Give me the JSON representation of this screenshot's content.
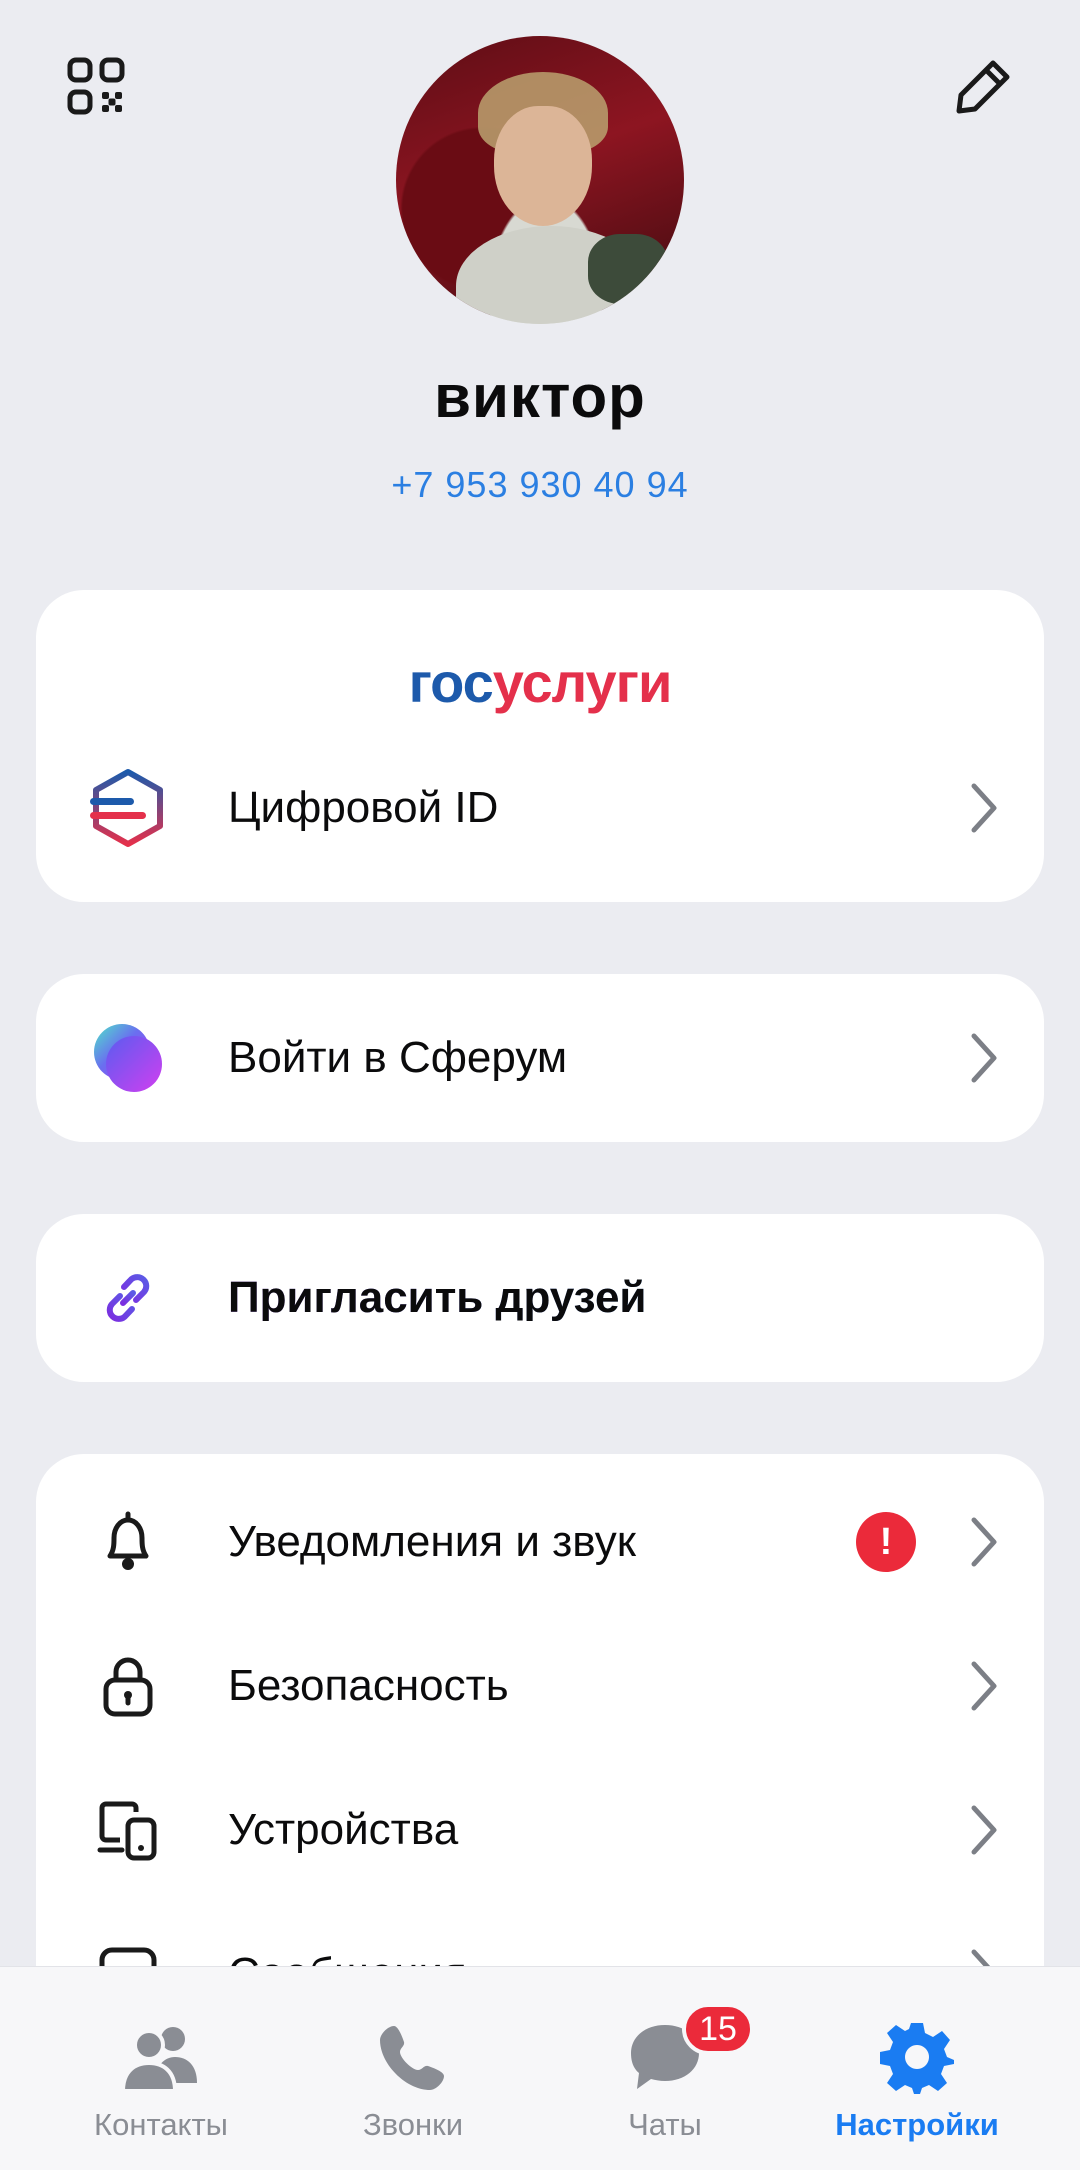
{
  "profile": {
    "name": "виктор",
    "phone": "+7 953 930 40 94"
  },
  "gosuslugi": {
    "logo_part1": "гос",
    "logo_part2": "услуги",
    "digital_id_label": "Цифровой ID"
  },
  "sferum": {
    "label": "Войти в Сферум"
  },
  "invite": {
    "label": "Пригласить друзей"
  },
  "settings": {
    "items": [
      {
        "label": "Уведомления и звук",
        "icon": "bell-icon",
        "alert": "!"
      },
      {
        "label": "Безопасность",
        "icon": "lock-icon"
      },
      {
        "label": "Устройства",
        "icon": "devices-icon"
      },
      {
        "label": "Сообщения",
        "icon": "messages-icon"
      }
    ]
  },
  "bottom_nav": {
    "items": [
      {
        "label": "Контакты",
        "icon": "contacts-icon"
      },
      {
        "label": "Звонки",
        "icon": "phone-icon"
      },
      {
        "label": "Чаты",
        "icon": "chat-icon",
        "badge": "15"
      },
      {
        "label": "Настройки",
        "icon": "gear-icon",
        "active": true
      }
    ]
  },
  "colors": {
    "accent": "#1a7cf2",
    "background": "#ebecf1",
    "alert": "#eb2a3a",
    "gos_blue": "#1d5aab",
    "gos_red": "#e4304b"
  }
}
